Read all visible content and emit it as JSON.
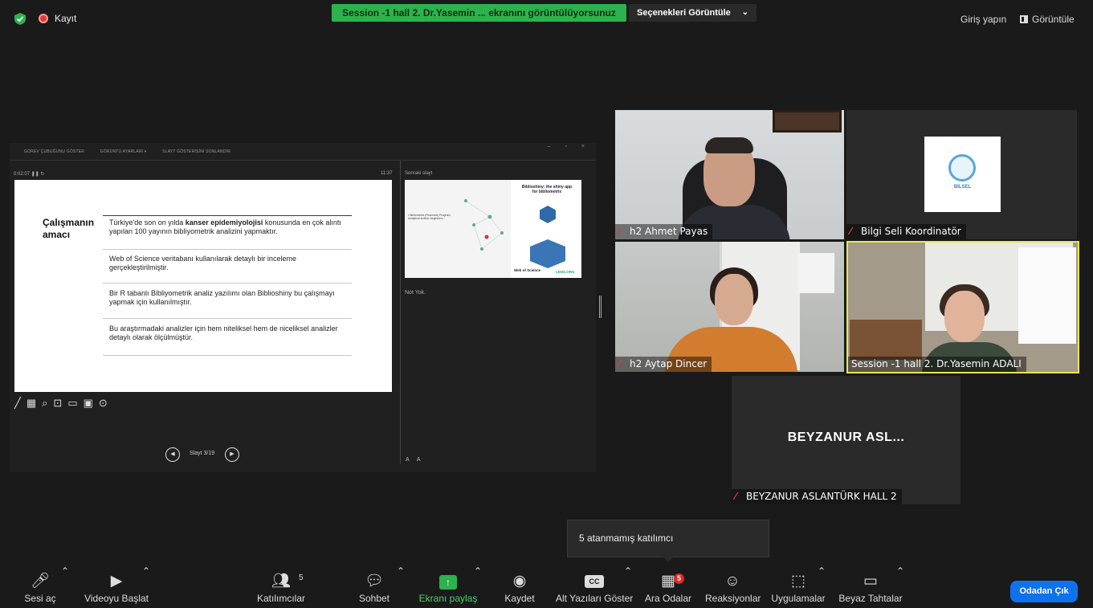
{
  "topbar": {
    "recording_label": "Kayıt",
    "share_banner": "Session -1 hall 2. Dr.Yasemin ... ekranını görüntülüyorsunuz",
    "view_options": "Seçenekleri Görüntüle",
    "sign_in": "Giriş yapın",
    "view": "Görüntüle"
  },
  "presenter": {
    "top_items": [
      "GÖREV ÇUBUĞUNU GÖSTER",
      "GÖRÜNTÜ AYARLARI ▾",
      "SLAYT GÖSTERİSİNİ SONLANDIR"
    ],
    "timer": "0:02:07",
    "clock": "11:37",
    "next_slide_label": "Sonraki slayt",
    "notes": "Not Yok.",
    "slide_counter": "Slayt 3/19",
    "font_buttons": "A A",
    "next_slide": {
      "header": "Biblioshiny: the shiny app for bibliometrix",
      "web_of_science": "Web of Science",
      "lens": "LENS.ORG"
    }
  },
  "slide": {
    "title_line1": "Çalışmanın",
    "title_line2": "amacı",
    "item1_pre": "Türkiye'de son on yılda ",
    "item1_bold": "kanser epidemiyolojisi",
    "item1_post": " konusunda en çok alıntı yapılan 100 yayının bibliyometrik analizini yapmaktır.",
    "item2": "Web of Science veritabanı kullanılarak detaylı bir inceleme gerçekleştirilmiştir.",
    "item3": "Bir R tabanlı Bibliyometrik analiz yazılımı olan Biblioshiny bu çalışmayı yapmak için kullanılmıştır.",
    "item4": "Bu araştırmadaki analizler için hem niteliksel hem de niceliksel analizler detaylı olarak ölçülmüştür."
  },
  "participants": {
    "p1": "h2 Ahmet Payas",
    "p2": "Bilgi Seli Koordinatör",
    "p2_logo_text": "BİLSEL",
    "p3": "h2 Aytap Dincer",
    "p4": "Session -1 hall 2. Dr.Yasemin ADALI",
    "p5_big": "BEYZANUR ASL...",
    "p5": "BEYZANUR ASLANTÜRK HALL 2"
  },
  "tooltip": "5 atanmamış katılımcı",
  "toolbar": {
    "unmute": "Sesi aç",
    "start_video": "Videoyu Başlat",
    "participants": "Katılımcılar",
    "participants_count": "5",
    "chat": "Sohbet",
    "share_screen": "Ekranı paylaş",
    "record": "Kaydet",
    "captions": "Alt Yazıları Göster",
    "captions_icon": "CC",
    "breakout": "Ara Odalar",
    "breakout_badge": "5",
    "reactions": "Reaksiyonlar",
    "apps": "Uygulamalar",
    "whiteboards": "Beyaz Tahtalar",
    "leave": "Odadan Çık"
  },
  "colors": {
    "share_green": "#2cb24e",
    "leave_blue": "#0e72ed",
    "mute_red": "#e53935",
    "active_speaker": "#e5e94a"
  },
  "icons": [
    "shield-icon",
    "record-icon",
    "mic-off-icon",
    "video-off-icon",
    "participants-icon",
    "chat-icon",
    "share-icon",
    "record-circle-icon",
    "captions-icon",
    "breakout-icon",
    "reactions-icon",
    "apps-icon",
    "whiteboard-icon"
  ]
}
